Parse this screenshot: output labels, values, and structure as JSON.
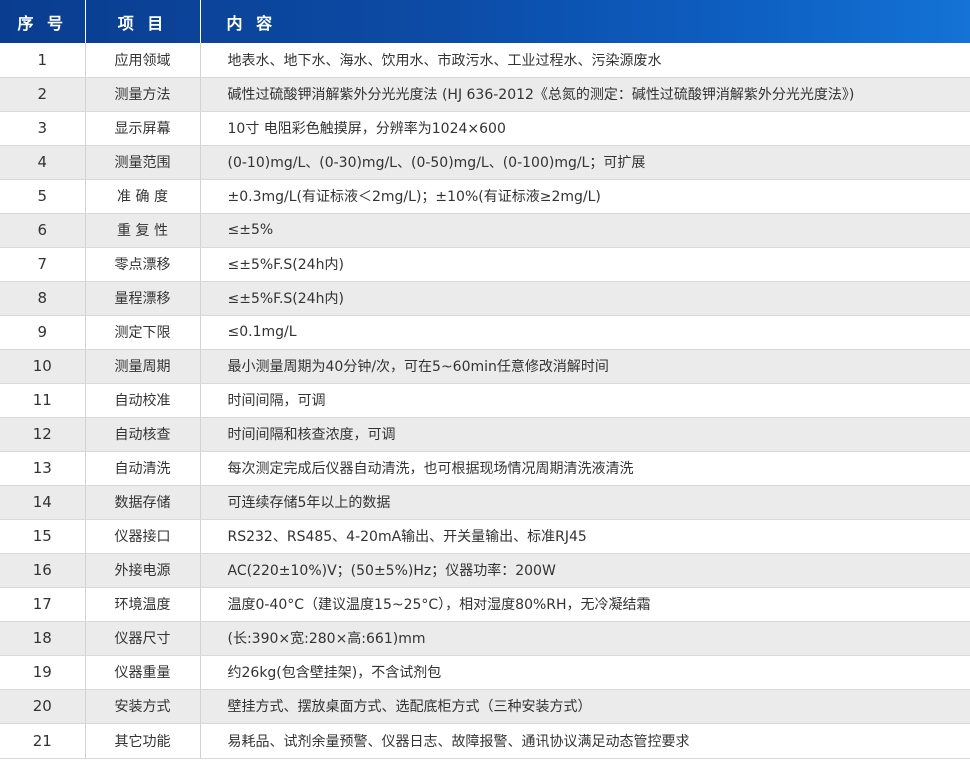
{
  "header": {
    "col_index": "序 号",
    "col_item": "项 目",
    "col_content": "内 容"
  },
  "rows": [
    {
      "no": "1",
      "item": "应用领域",
      "content": "地表水、地下水、海水、饮用水、市政污水、工业过程水、污染源废水"
    },
    {
      "no": "2",
      "item": "测量方法",
      "content": "碱性过硫酸钾消解紫外分光光度法 (HJ 636-2012《总氮的测定：碱性过硫酸钾消解紫外分光光度法》)"
    },
    {
      "no": "3",
      "item": "显示屏幕",
      "content": "10寸 电阻彩色触摸屏，分辨率为1024×600"
    },
    {
      "no": "4",
      "item": "测量范围",
      "content": "(0-10)mg/L、(0-30)mg/L、(0-50)mg/L、(0-100)mg/L；可扩展"
    },
    {
      "no": "5",
      "item": "准 确 度",
      "content": "±0.3mg/L(有证标液＜2mg/L)；±10%(有证标液≥2mg/L)"
    },
    {
      "no": "6",
      "item": "重 复 性",
      "content": "≤±5%"
    },
    {
      "no": "7",
      "item": "零点漂移",
      "content": "≤±5%F.S(24h内)"
    },
    {
      "no": "8",
      "item": "量程漂移",
      "content": "≤±5%F.S(24h内)"
    },
    {
      "no": "9",
      "item": "测定下限",
      "content": "≤0.1mg/L"
    },
    {
      "no": "10",
      "item": "测量周期",
      "content": "最小测量周期为40分钟/次，可在5~60min任意修改消解时间"
    },
    {
      "no": "11",
      "item": "自动校准",
      "content": "时间间隔，可调"
    },
    {
      "no": "12",
      "item": "自动核查",
      "content": "时间间隔和核查浓度，可调"
    },
    {
      "no": "13",
      "item": "自动清洗",
      "content": "每次测定完成后仪器自动清洗，也可根据现场情况周期清洗液清洗"
    },
    {
      "no": "14",
      "item": "数据存储",
      "content": "可连续存储5年以上的数据"
    },
    {
      "no": "15",
      "item": "仪器接口",
      "content": "RS232、RS485、4-20mA输出、开关量输出、标准RJ45"
    },
    {
      "no": "16",
      "item": "外接电源",
      "content": "AC(220±10%)V；(50±5%)Hz；仪器功率：200W"
    },
    {
      "no": "17",
      "item": "环境温度",
      "content": "温度0-40°C（建议温度15~25°C），相对湿度80%RH，无冷凝结霜"
    },
    {
      "no": "18",
      "item": "仪器尺寸",
      "content": "(长:390×宽:280×高:661)mm"
    },
    {
      "no": "19",
      "item": "仪器重量",
      "content": "约26kg(包含壁挂架)，不含试剂包"
    },
    {
      "no": "20",
      "item": "安装方式",
      "content": "壁挂方式、摆放桌面方式、选配底柜方式（三种安装方式）"
    },
    {
      "no": "21",
      "item": "其它功能",
      "content": "易耗品、试剂余量预警、仪器日志、故障报警、通讯协议满足动态管控要求"
    }
  ]
}
